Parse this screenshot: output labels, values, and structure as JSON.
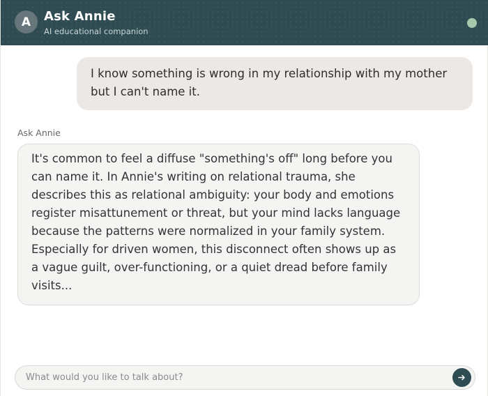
{
  "header": {
    "avatar_letter": "A",
    "title": "Ask Annie",
    "subtitle": "AI educational companion"
  },
  "conversation": {
    "user_message": "I know something is wrong in my relationship with my mother but I can't name it.",
    "assistant_name": "Ask Annie",
    "assistant_message": "It's common to feel a diffuse \"something's off\" long before you can name it. In Annie's writing on relational trauma, she describes this as relational ambiguity: your body and emotions register misattunement or threat, but your mind lacks language because the patterns were normalized in your family system. Especially for driven women, this disconnect often shows up as a vague guilt, over-functioning, or a quiet dread before family visits..."
  },
  "composer": {
    "placeholder": "What would you like to talk about?",
    "value": "",
    "send_icon": "arrow-right-icon"
  },
  "colors": {
    "header_bg": "#2f4c52",
    "status_dot": "#a6c9ad",
    "user_bubble": "#ebe8e5",
    "assistant_bubble": "#f4f4f3"
  }
}
